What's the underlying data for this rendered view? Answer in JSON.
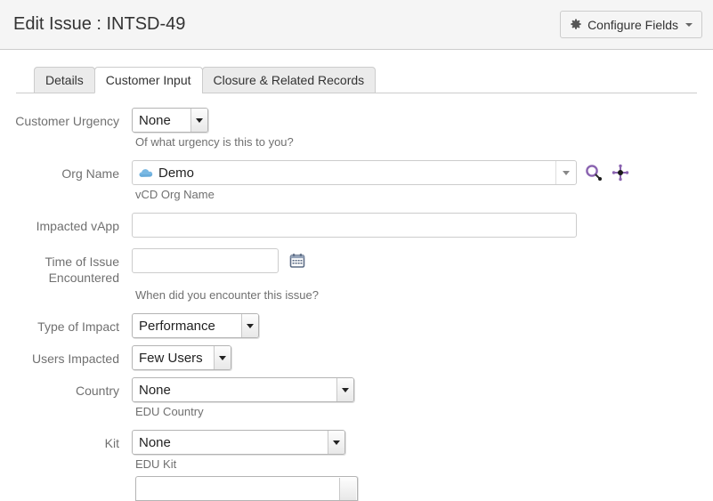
{
  "header": {
    "title": "Edit Issue : INTSD-49",
    "configure_fields_label": "Configure Fields",
    "gear_icon": "gear-icon",
    "caret_icon": "chevron-down-icon"
  },
  "tabs": [
    {
      "label": "Details",
      "active": false
    },
    {
      "label": "Customer Input",
      "active": true
    },
    {
      "label": "Closure & Related Records",
      "active": false
    }
  ],
  "form": {
    "customer_urgency": {
      "label": "Customer Urgency",
      "value": "None",
      "options": [
        "None"
      ],
      "help": "Of what urgency is this to you?"
    },
    "org_name": {
      "label": "Org Name",
      "value": "Demo",
      "icon": "cloud-icon",
      "help": "vCD Org Name",
      "search_icon": "search-icon",
      "picker_icon": "crosshair-move-icon"
    },
    "impacted_vapp": {
      "label": "Impacted vApp",
      "value": "",
      "placeholder": ""
    },
    "time_of_issue": {
      "label_line1": "Time of Issue",
      "label_line2": "Encountered",
      "value": "",
      "placeholder": "",
      "help": "When did you encounter this issue?",
      "calendar_icon": "calendar-icon"
    },
    "type_of_impact": {
      "label": "Type of Impact",
      "value": "Performance",
      "options": [
        "Performance"
      ]
    },
    "users_impacted": {
      "label": "Users Impacted",
      "value": "Few Users",
      "options": [
        "Few Users"
      ]
    },
    "country": {
      "label": "Country",
      "value": "None",
      "options": [
        "None"
      ],
      "help": "EDU Country"
    },
    "kit": {
      "label": "Kit",
      "value": "None",
      "options": [
        "None"
      ],
      "help": "EDU Kit"
    }
  },
  "colors": {
    "header_bg": "#f5f5f5",
    "border": "#cccccc",
    "label_text": "#707070",
    "title_text": "#333333",
    "accent_icon": "#8a63b0",
    "cloud_icon": "#6aaee0"
  }
}
